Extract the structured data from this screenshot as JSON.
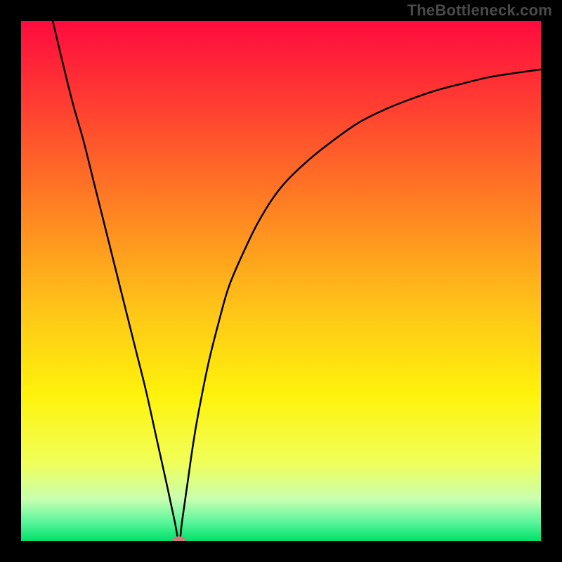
{
  "watermark": "TheBottleneck.com",
  "colors": {
    "frame": "#000000",
    "watermark_text": "#4a4a4a",
    "curve": "#000000",
    "marker_fill": "#cf7a72",
    "gradient_stops": [
      {
        "offset": 0.0,
        "color": "#ff0b3e"
      },
      {
        "offset": 0.15,
        "color": "#ff3a32"
      },
      {
        "offset": 0.35,
        "color": "#ff7e23"
      },
      {
        "offset": 0.55,
        "color": "#ffc318"
      },
      {
        "offset": 0.72,
        "color": "#fef30b"
      },
      {
        "offset": 0.85,
        "color": "#f0ff5a"
      },
      {
        "offset": 0.92,
        "color": "#c8ffb0"
      },
      {
        "offset": 0.965,
        "color": "#57f59a"
      },
      {
        "offset": 1.0,
        "color": "#00e06a"
      }
    ]
  },
  "chart_data": {
    "type": "line",
    "title": "",
    "xlabel": "",
    "ylabel": "",
    "xlim": [
      0,
      100
    ],
    "ylim": [
      0,
      100
    ],
    "grid": false,
    "legend": false,
    "notes": "Axes have no visible tick labels. The curve depicts a bottleneck-like metric: high (bad/red) at the x-extremes, dropping to 0 (good/green) at a single minimum. Values below are estimated from pixel positions on a 0-100 normalized scale.",
    "minimum": {
      "x": 30.4,
      "y": 0
    },
    "series": [
      {
        "name": "bottleneck-curve",
        "x": [
          6.1,
          8,
          10,
          12,
          14,
          16,
          18,
          20,
          22,
          24,
          26,
          28,
          29.5,
          30.4,
          31,
          32,
          33,
          34,
          36,
          38,
          40,
          43,
          46,
          50,
          55,
          60,
          65,
          70,
          75,
          80,
          85,
          90,
          95,
          100
        ],
        "y": [
          100,
          92,
          84,
          77,
          69,
          61,
          53,
          45,
          37,
          29,
          20,
          11,
          4,
          0,
          4,
          11,
          18,
          24,
          34,
          42,
          49,
          56,
          62,
          68,
          73,
          77,
          80.5,
          83,
          85,
          86.7,
          88,
          89.2,
          90,
          90.7
        ]
      }
    ],
    "markers": [
      {
        "name": "current-position",
        "x": 30.4,
        "y": 0,
        "rx": 1.3,
        "ry": 0.9
      }
    ]
  }
}
